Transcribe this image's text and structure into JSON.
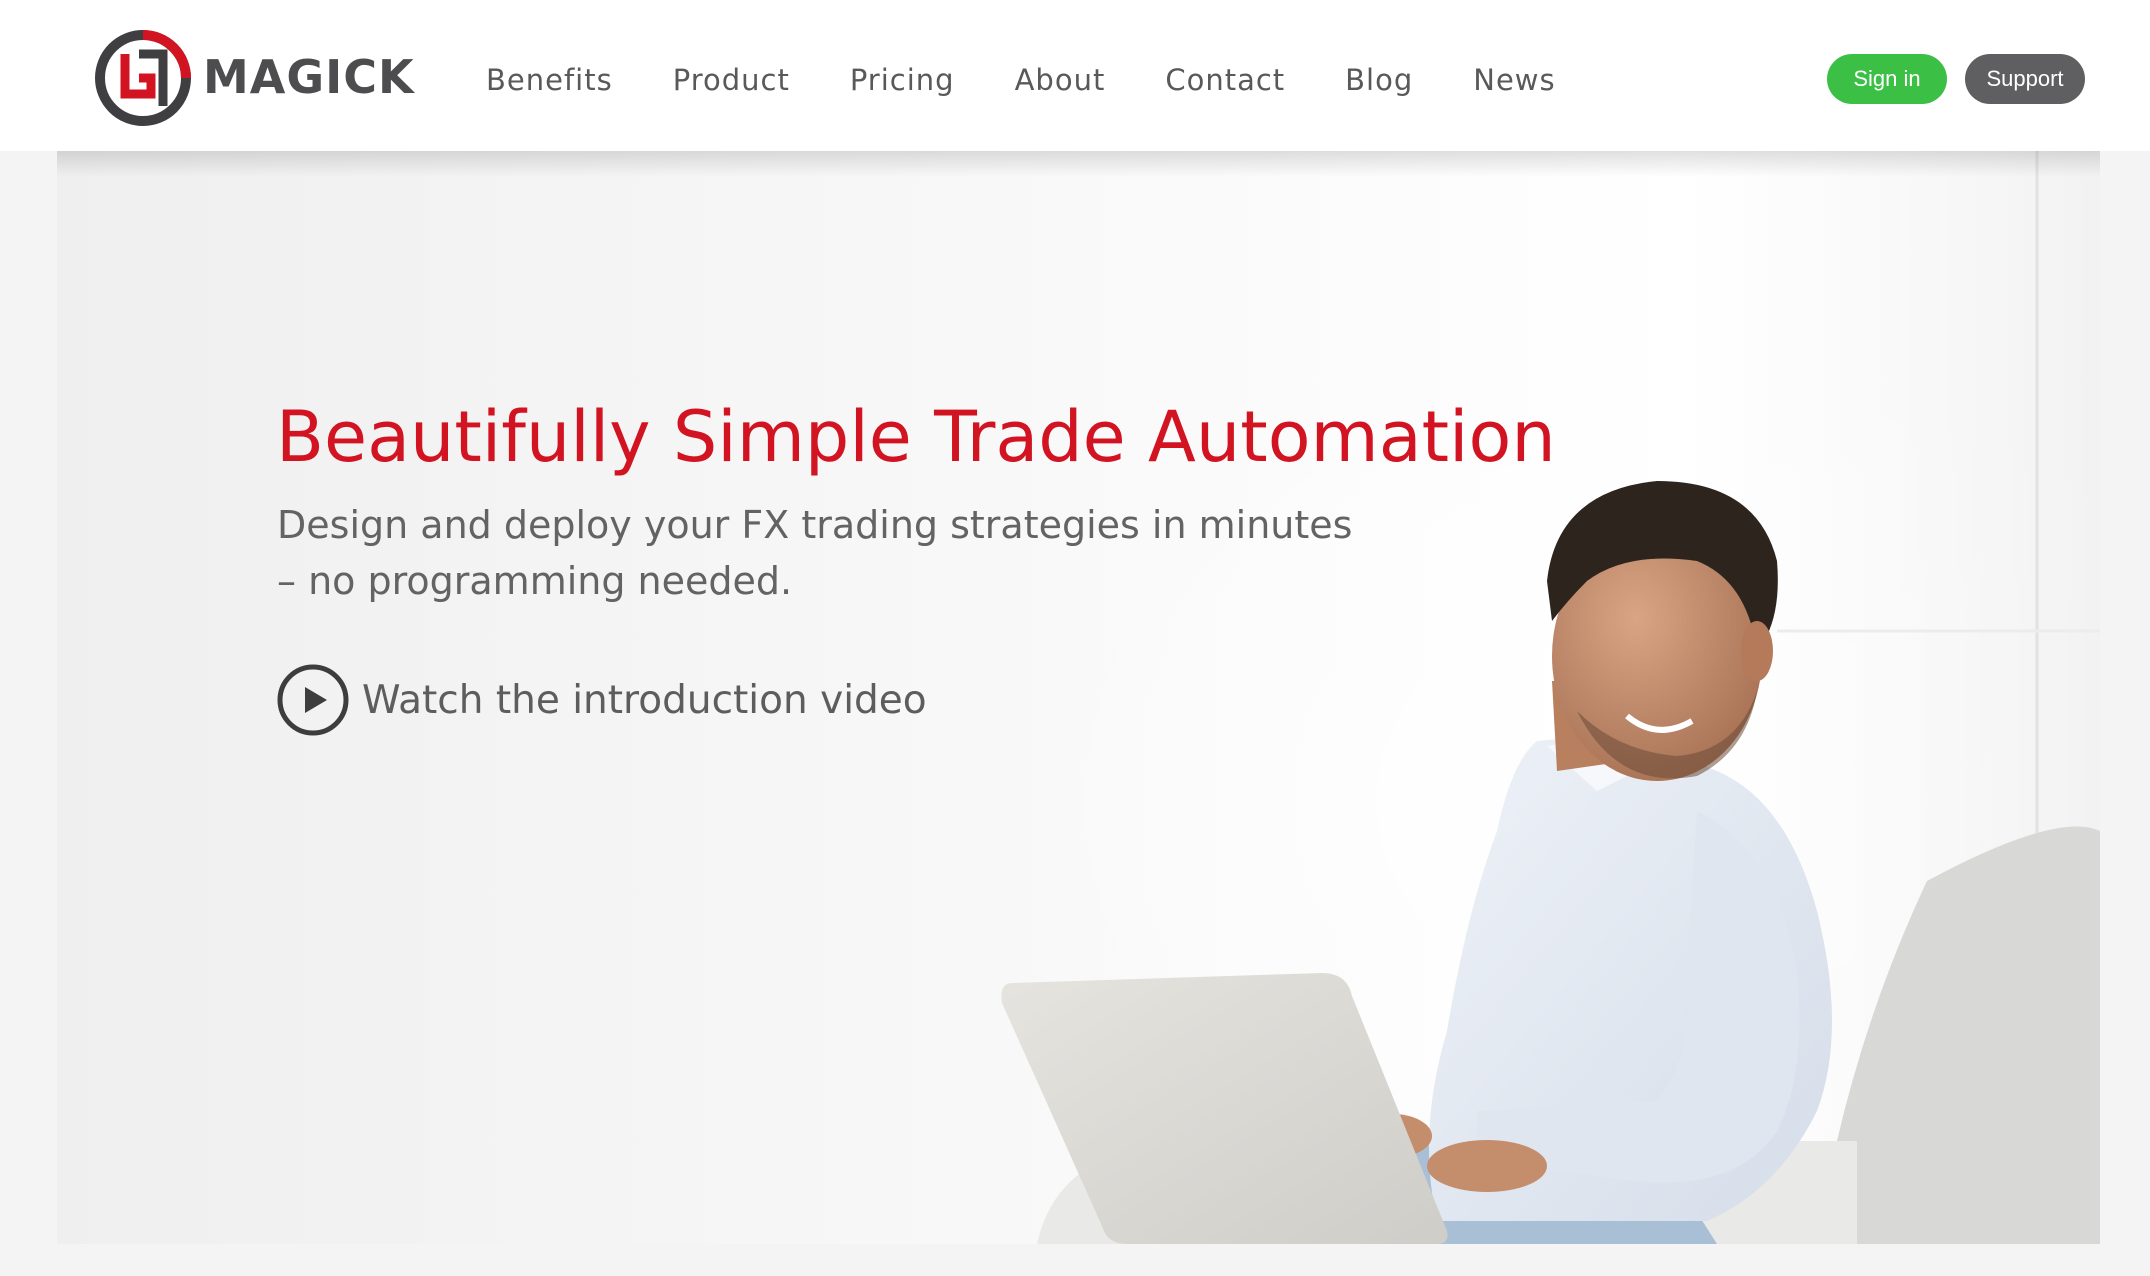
{
  "header": {
    "brand": "MAGICK",
    "nav": [
      "Benefits",
      "Product",
      "Pricing",
      "About",
      "Contact",
      "Blog",
      "News"
    ],
    "sign_in_label": "Sign in",
    "support_label": "Support"
  },
  "hero": {
    "title": "Beautifully Simple Trade Automation",
    "subtitle_line1": "Design and deploy your FX trading strategies in minutes",
    "subtitle_line2": "– no programming needed.",
    "video_link": "Watch the introduction video"
  },
  "colors": {
    "brand_red": "#d21422",
    "sign_in_green": "#3bbf45",
    "support_gray": "#5f5f61",
    "text_gray": "#636363"
  },
  "icons": {
    "logo": "magick-logo-icon",
    "play": "play-circle-icon"
  }
}
